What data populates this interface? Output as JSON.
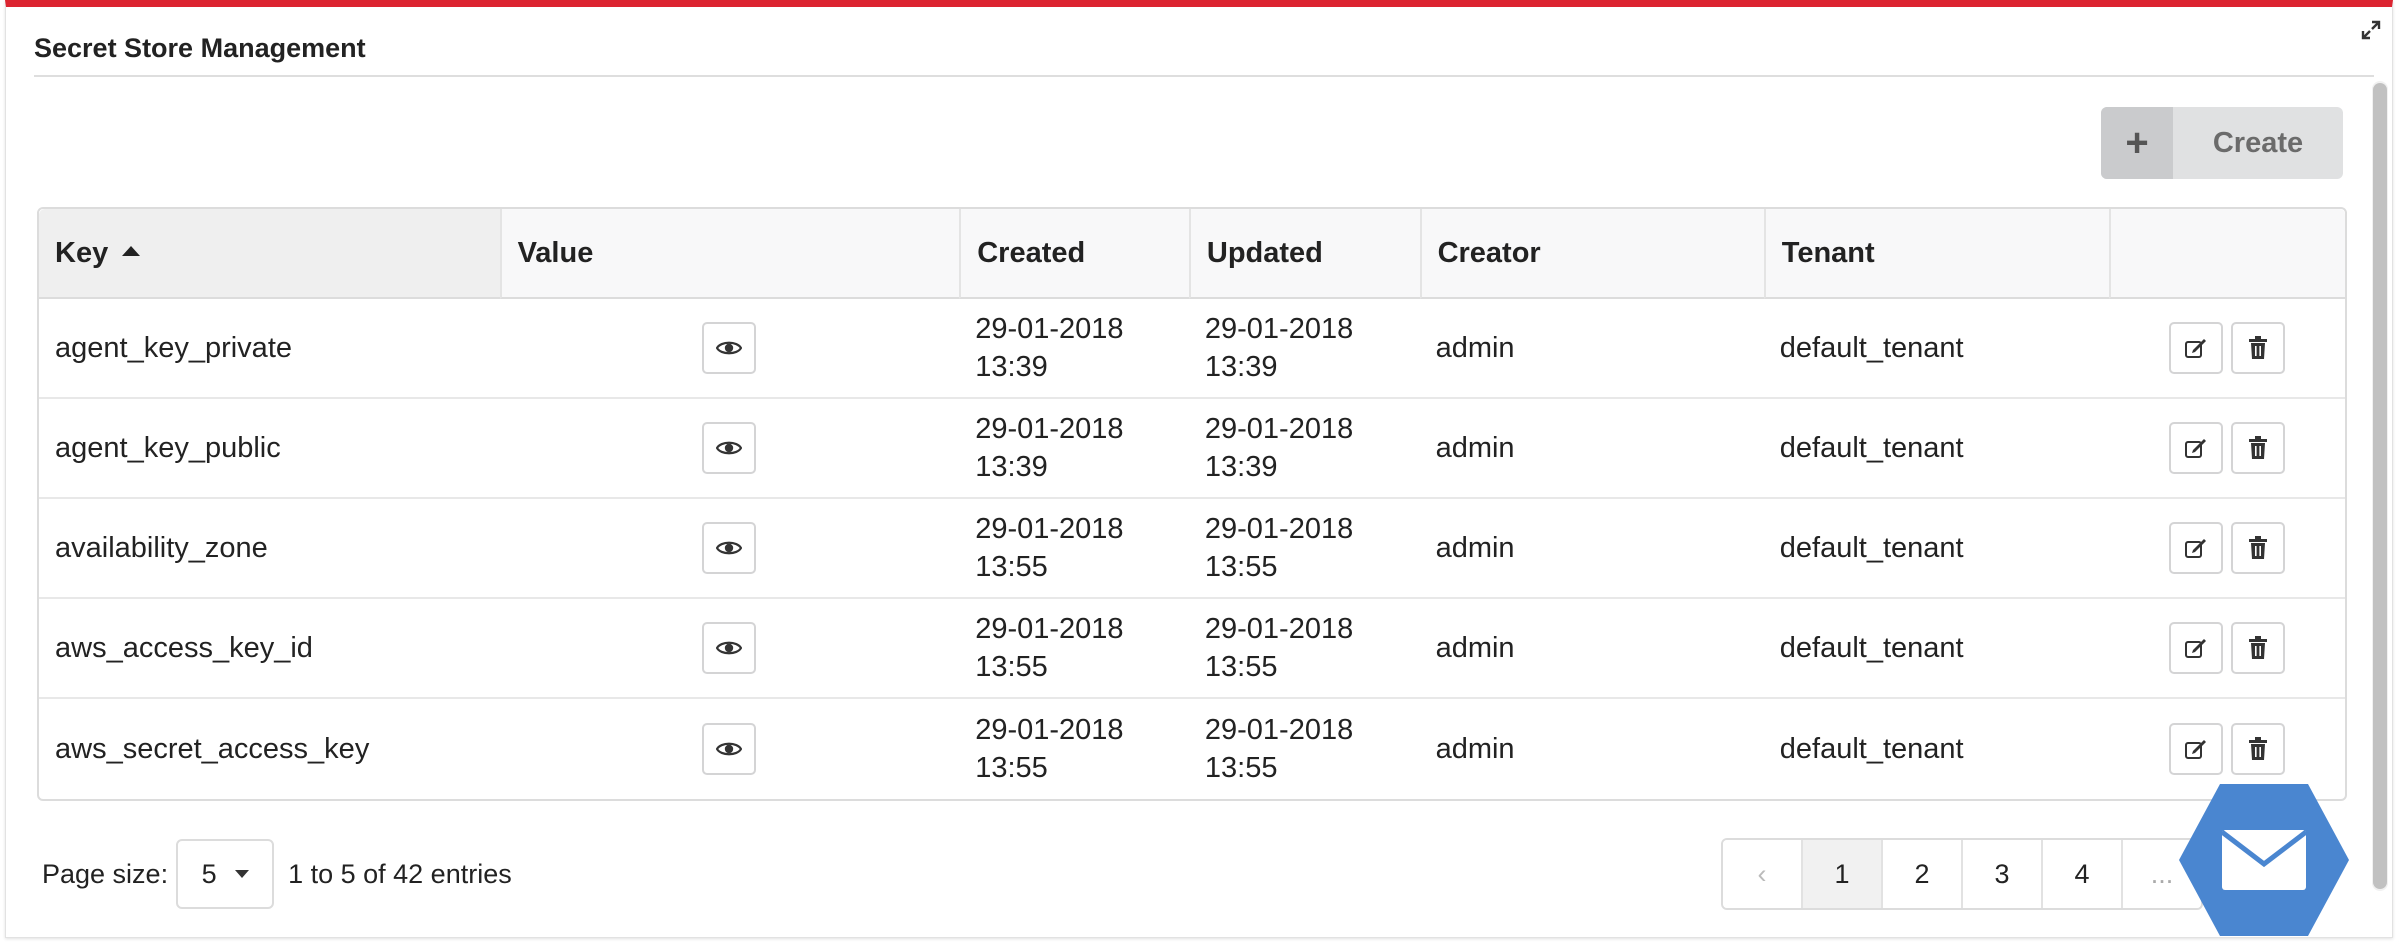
{
  "panel": {
    "title": "Secret Store Management"
  },
  "toolbar": {
    "create_label": "Create",
    "create_icon": "plus-icon"
  },
  "table": {
    "columns": [
      "Key",
      "Value",
      "Created",
      "Updated",
      "Creator",
      "Tenant",
      ""
    ],
    "sort": {
      "column": "Key",
      "direction": "ascending"
    },
    "rows": [
      {
        "key": "agent_key_private",
        "created_date": "29-01-2018",
        "created_time": "13:39",
        "updated_date": "29-01-2018",
        "updated_time": "13:39",
        "creator": "admin",
        "tenant": "default_tenant"
      },
      {
        "key": "agent_key_public",
        "created_date": "29-01-2018",
        "created_time": "13:39",
        "updated_date": "29-01-2018",
        "updated_time": "13:39",
        "creator": "admin",
        "tenant": "default_tenant"
      },
      {
        "key": "availability_zone",
        "created_date": "29-01-2018",
        "created_time": "13:55",
        "updated_date": "29-01-2018",
        "updated_time": "13:55",
        "creator": "admin",
        "tenant": "default_tenant"
      },
      {
        "key": "aws_access_key_id",
        "created_date": "29-01-2018",
        "created_time": "13:55",
        "updated_date": "29-01-2018",
        "updated_time": "13:55",
        "creator": "admin",
        "tenant": "default_tenant"
      },
      {
        "key": "aws_secret_access_key",
        "created_date": "29-01-2018",
        "created_time": "13:55",
        "updated_date": "29-01-2018",
        "updated_time": "13:55",
        "creator": "admin",
        "tenant": "default_tenant"
      }
    ]
  },
  "pager": {
    "page_size_label": "Page size:",
    "page_size_value": "5",
    "entries_text": "1 to 5 of 42 entries",
    "prev": "‹",
    "pages": [
      "1",
      "2",
      "3",
      "4",
      "..."
    ],
    "active_page": "1"
  },
  "colors": {
    "accent_top": "#dc2430",
    "mail_button": "#4a86d0"
  },
  "icons": {
    "expand": "expand-icon",
    "view": "eye-icon",
    "edit": "edit-icon",
    "delete": "trash-icon",
    "mail": "mail-icon"
  }
}
